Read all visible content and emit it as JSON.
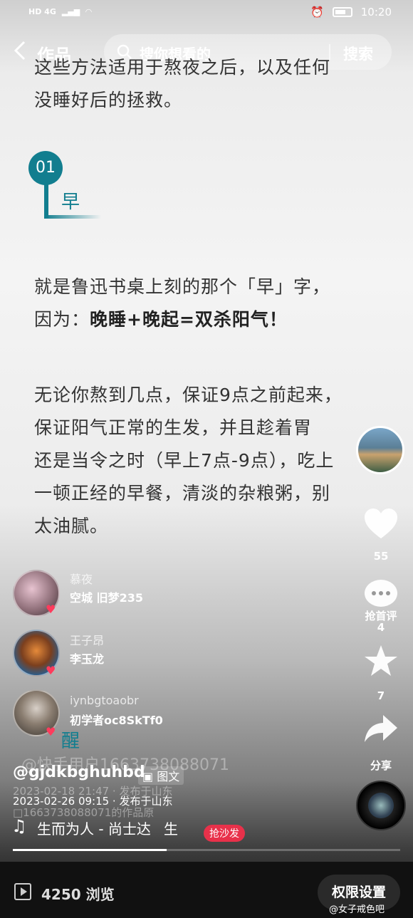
{
  "status_bar": {
    "network": "HD 4G",
    "time": "10:20"
  },
  "header": {
    "back": "<",
    "title": "作品",
    "search_placeholder": "搜你想看的",
    "search_button": "搜索"
  },
  "article": {
    "intro": [
      "这些方法适用于熬夜之后，以及任何",
      "没睡好后的拯救。"
    ],
    "section1": {
      "number": "01",
      "label": "早"
    },
    "para1_line1": "就是鲁迅书桌上刻的那个「早」字，",
    "para1_line2_prefix": "因为：",
    "para1_line2_bold": "晚睡+晚起=双杀阳气！",
    "para2": [
      "无论你熬到几点，保证9点之前起来，",
      "保证阳气正常的生发，并且趁着胃",
      "还是当令之时（早上7点-9点），吃上",
      "一顿正经的早餐，清淡的杂粮粥，别",
      "太油腻。"
    ],
    "section2_label": "醒"
  },
  "rail": {
    "like_count": "55",
    "comment_label": "抢首评",
    "comment_count": "4",
    "favorite_count": "7",
    "share_label": "分享"
  },
  "comments": [
    {
      "top": "慕夜",
      "name": "空城 旧梦235"
    },
    {
      "top": "王子昂",
      "name": "李玉龙"
    },
    {
      "top": "iynbgtoaobr",
      "name": "初学者oc8SkTf0"
    }
  ],
  "post": {
    "author_ghost": "@快手用户1663738088071",
    "author": "@gjdkbghuhbd",
    "tag": "图文",
    "date_ghost": "2023-02-18 21:47 · 发布于山东",
    "date": "2023-02-26 09:15 · 发布于山东",
    "ghost_line": "□1663738088071的作品原",
    "music": "生而为人 - 尚士达",
    "music_tail": "生",
    "sofa": "抢沙发"
  },
  "bottom": {
    "views": "4250 浏览",
    "permission": "权限设置",
    "watermark": "@女子戒色吧"
  },
  "colors": {
    "accent": "#127e8f",
    "heart": "#ff3b5c",
    "sofa": "#e8314a"
  }
}
